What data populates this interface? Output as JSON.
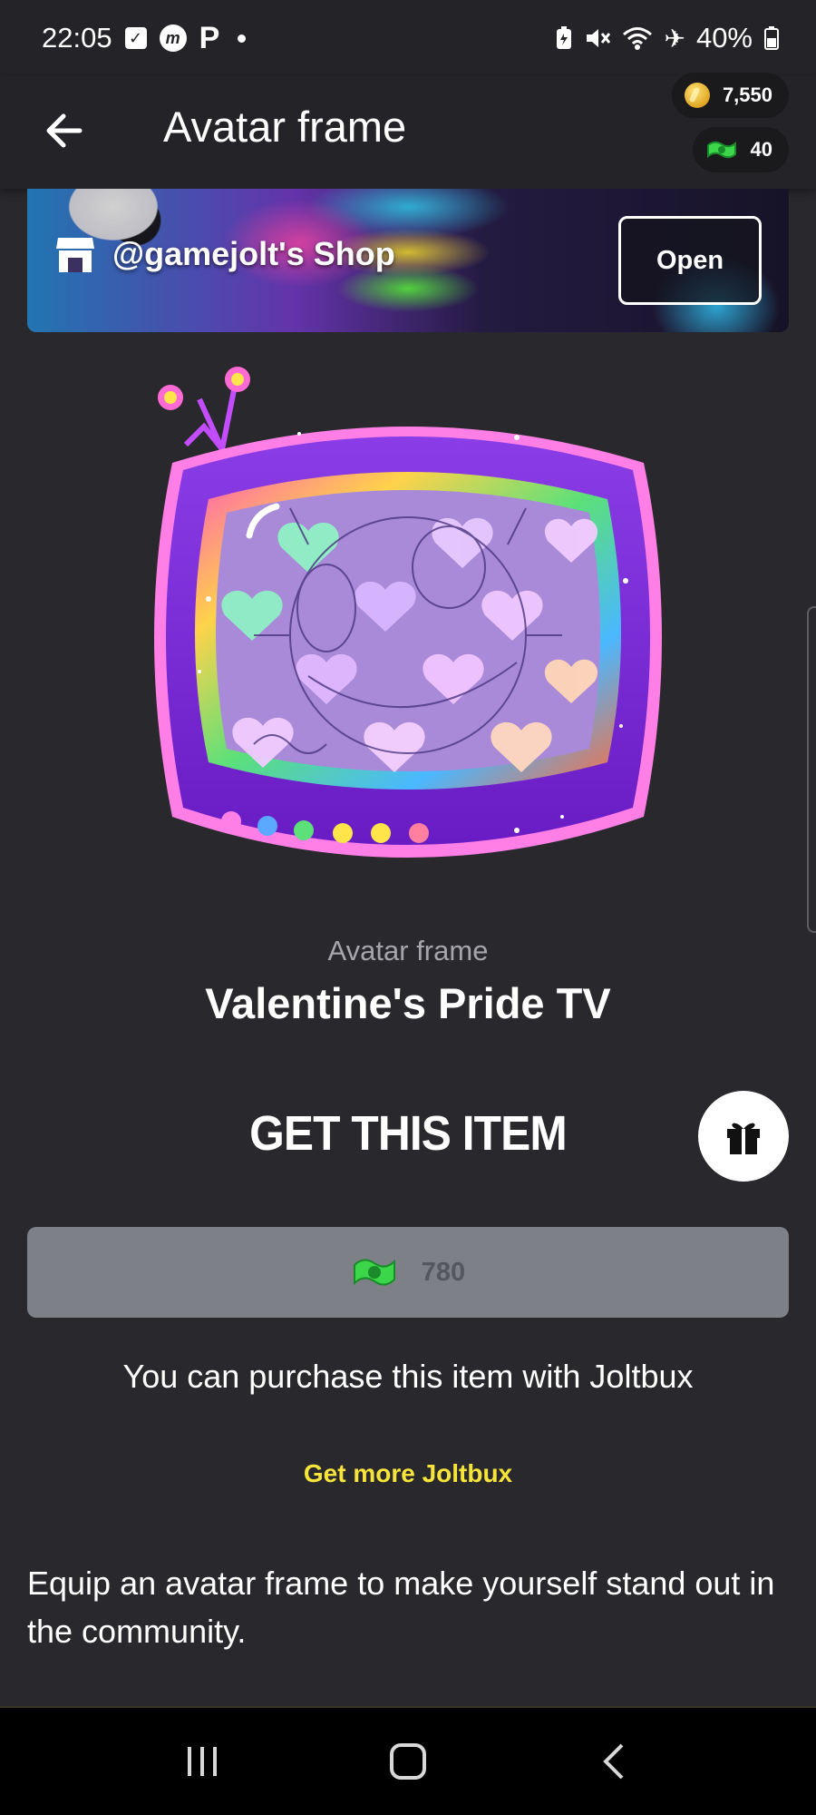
{
  "status_bar": {
    "time": "22:05",
    "battery": "40%",
    "icons": [
      "check-box-icon",
      "messenger-icon",
      "p-icon",
      "dot-icon",
      "battery-saver-icon",
      "mute-icon",
      "wifi-icon",
      "airplane-icon",
      "battery-icon"
    ]
  },
  "header": {
    "title": "Avatar frame",
    "back_icon": "arrow-left-icon",
    "coins": "7,550",
    "joltbux": "40"
  },
  "shop": {
    "name": "@gamejolt's Shop",
    "open_label": "Open",
    "icon": "store-icon"
  },
  "item": {
    "type": "Avatar frame",
    "name": "Valentine's Pride TV"
  },
  "purchase": {
    "heading": "GET THIS ITEM",
    "gift_icon": "gift-icon",
    "price": "780",
    "note": "You can purchase this item with Joltbux",
    "get_more_label": "Get more Joltbux"
  },
  "description": "Equip an avatar frame to make yourself stand out in the community.",
  "nav": {
    "icons": [
      "recent-apps-icon",
      "home-icon",
      "back-icon"
    ]
  },
  "colors": {
    "background": "#29292d",
    "header": "#242428",
    "link": "#f7e43a",
    "price_button": "#7d8087",
    "frame_purple": "#7a2bd6"
  }
}
